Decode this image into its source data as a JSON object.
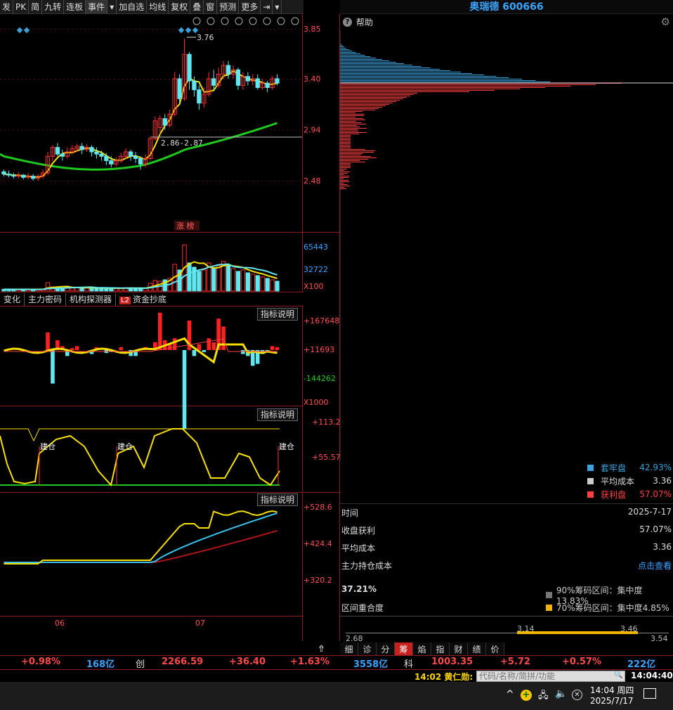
{
  "toolbar": {
    "items": [
      "发",
      "PK",
      "简",
      "九转",
      "连板",
      "事件",
      "▾",
      "加自选",
      "均线",
      "复权",
      "叠",
      "窗",
      "预测",
      "更多",
      "⇥",
      "▾"
    ]
  },
  "stock_title": "奥瑞德 600666",
  "price_axis": {
    "labels": [
      "3.85",
      "3.40",
      "2.94",
      "2.48"
    ]
  },
  "high_marker": "3.76",
  "cost_range_label": "2.86-2.87",
  "zhangbang_label": "涨 榜",
  "volume_axis": {
    "labels": [
      "65443",
      "32722",
      "X100"
    ]
  },
  "indicator_tabs": {
    "items": [
      "变化",
      "主力密码",
      "机构探测器"
    ],
    "l2_badge": "L2",
    "l2_label": "资金抄底"
  },
  "panel1": {
    "button": "指标说明",
    "labels": [
      "+167648",
      "+11693",
      "-144262",
      "X1000"
    ]
  },
  "panel2": {
    "button": "指标说明",
    "labels": [
      "+113.2",
      "+55.57"
    ],
    "marks": [
      "建仓",
      "建仓",
      "建仓"
    ]
  },
  "panel3": {
    "button": "指标说明",
    "labels": [
      "+528.6",
      "+424.4",
      "+320.2"
    ]
  },
  "time_axis": {
    "labels": [
      "06",
      "07"
    ]
  },
  "chips": {
    "help": "帮助",
    "legend": [
      {
        "label": "套牢盘",
        "value": "42.93%",
        "color": "#3ba3d9",
        "label_color": "#3ba3d9",
        "value_color": "#3ba3d9"
      },
      {
        "label": "平均成本",
        "value": "3.36",
        "color": "#cccccc",
        "label_color": "#dddddd",
        "value_color": "#dddddd"
      },
      {
        "label": "获利盘",
        "value": "57.07%",
        "color": "#ff4040",
        "label_color": "#ff4040",
        "value_color": "#ff4040"
      }
    ],
    "info": [
      {
        "label": "时间",
        "value": "2025-7-17"
      },
      {
        "label": "收盘获利",
        "value": "57.07%"
      },
      {
        "label": "平均成本",
        "value": "3.36"
      },
      {
        "label": "主力持仓成本",
        "value": "点击查看"
      }
    ],
    "overlap_pct": "37.21%",
    "overlap_label": "区间重合度",
    "range90": "90%筹码区间：集中度13.83%",
    "range70": "70%筹码区间：集中度4.85%",
    "scale": {
      "min": "2.68",
      "mid1": "3.14",
      "mid2": "3.46",
      "max": "3.54"
    }
  },
  "bottom_tabs": {
    "items": [
      "细",
      "诊",
      "分",
      "筹",
      "焰",
      "指",
      "财",
      "绩",
      "价"
    ],
    "active": "筹"
  },
  "index_bar": {
    "pct1": "+0.98%",
    "amount1": "168亿",
    "chuang": "创",
    "chuang_value": "2266.59",
    "chuang_change": "+36.40",
    "chuang_pct": "+1.63%",
    "amount2": "3558亿",
    "ke": "科",
    "ke_value": "1003.35",
    "ke_change": "+5.72",
    "ke_pct": "+0.57%",
    "amount3": "222亿"
  },
  "status_bar": {
    "news": "14:02 黄仁勋:",
    "search_placeholder": "代码/名称/简拼/功能",
    "clock": "14:04:40"
  },
  "taskbar": {
    "time": "14:04 周四",
    "date": "2025/7/17"
  },
  "chart_data": {
    "type": "candlestick",
    "price_ylim": [
      2.4,
      3.9
    ],
    "candles": [
      [
        2.56,
        2.54,
        2.58,
        2.52
      ],
      [
        2.54,
        2.53,
        2.57,
        2.51
      ],
      [
        2.53,
        2.52,
        2.55,
        2.5
      ],
      [
        2.52,
        2.53,
        2.56,
        2.5
      ],
      [
        2.53,
        2.51,
        2.54,
        2.49
      ],
      [
        2.51,
        2.52,
        2.55,
        2.49
      ],
      [
        2.52,
        2.5,
        2.54,
        2.48
      ],
      [
        2.5,
        2.52,
        2.54,
        2.48
      ],
      [
        2.52,
        2.55,
        2.58,
        2.5
      ],
      [
        2.55,
        2.7,
        2.74,
        2.53
      ],
      [
        2.7,
        2.78,
        2.8,
        2.66
      ],
      [
        2.78,
        2.72,
        2.82,
        2.7
      ],
      [
        2.72,
        2.7,
        2.76,
        2.66
      ],
      [
        2.7,
        2.74,
        2.78,
        2.68
      ],
      [
        2.74,
        2.77,
        2.8,
        2.72
      ],
      [
        2.77,
        2.79,
        2.81,
        2.74
      ],
      [
        2.79,
        2.76,
        2.82,
        2.72
      ],
      [
        2.76,
        2.78,
        2.81,
        2.74
      ],
      [
        2.78,
        2.74,
        2.8,
        2.7
      ],
      [
        2.74,
        2.72,
        2.78,
        2.68
      ],
      [
        2.72,
        2.7,
        2.75,
        2.66
      ],
      [
        2.7,
        2.66,
        2.73,
        2.62
      ],
      [
        2.66,
        2.63,
        2.7,
        2.6
      ],
      [
        2.63,
        2.66,
        2.69,
        2.61
      ],
      [
        2.66,
        2.7,
        2.73,
        2.64
      ],
      [
        2.7,
        2.74,
        2.77,
        2.68
      ],
      [
        2.74,
        2.7,
        2.76,
        2.66
      ],
      [
        2.7,
        2.68,
        2.74,
        2.64
      ],
      [
        2.68,
        2.63,
        2.7,
        2.58
      ],
      [
        2.63,
        2.68,
        2.72,
        2.6
      ],
      [
        2.68,
        2.86,
        2.88,
        2.66
      ],
      [
        2.86,
        3.02,
        3.06,
        2.84
      ],
      [
        2.96,
        3.04,
        3.07,
        2.9
      ],
      [
        3.04,
        2.98,
        3.08,
        2.94
      ],
      [
        2.98,
        3.08,
        3.12,
        2.96
      ],
      [
        3.08,
        3.4,
        3.46,
        3.06
      ],
      [
        3.4,
        3.22,
        3.44,
        3.18
      ],
      [
        3.22,
        3.62,
        3.76,
        3.2
      ],
      [
        3.62,
        3.38,
        3.64,
        3.3
      ],
      [
        3.38,
        3.3,
        3.42,
        3.24
      ],
      [
        3.3,
        3.18,
        3.34,
        3.12
      ],
      [
        3.18,
        3.26,
        3.32,
        3.14
      ],
      [
        3.26,
        3.4,
        3.46,
        3.24
      ],
      [
        3.4,
        3.34,
        3.48,
        3.3
      ],
      [
        3.34,
        3.44,
        3.5,
        3.32
      ],
      [
        3.44,
        3.52,
        3.56,
        3.4
      ],
      [
        3.52,
        3.44,
        3.56,
        3.4
      ],
      [
        3.44,
        3.48,
        3.52,
        3.4
      ],
      [
        3.48,
        3.34,
        3.5,
        3.3
      ],
      [
        3.34,
        3.42,
        3.46,
        3.3
      ],
      [
        3.42,
        3.38,
        3.46,
        3.34
      ],
      [
        3.38,
        3.4,
        3.44,
        3.34
      ],
      [
        3.4,
        3.32,
        3.44,
        3.3
      ],
      [
        3.32,
        3.36,
        3.4,
        3.3
      ],
      [
        3.36,
        3.32,
        3.38,
        3.28
      ],
      [
        3.32,
        3.4,
        3.42,
        3.3
      ],
      [
        3.4,
        3.36,
        3.44,
        3.34
      ]
    ],
    "volume_ylim": [
      0,
      70000
    ],
    "volumes": [
      2500,
      2400,
      2100,
      2300,
      2600,
      2200,
      2100,
      2400,
      3000,
      12000,
      6000,
      5500,
      4500,
      5000,
      5200,
      5000,
      4500,
      4200,
      4800,
      4500,
      3800,
      4200,
      3900,
      3500,
      4200,
      4800,
      4600,
      3800,
      4100,
      3600,
      11000,
      15000,
      14000,
      16000,
      18000,
      38000,
      30000,
      65443,
      40000,
      34000,
      28000,
      30000,
      40000,
      32000,
      36000,
      42000,
      36000,
      32000,
      28000,
      30000,
      26000,
      24000,
      22000,
      20000,
      18000,
      16000,
      14000
    ]
  }
}
